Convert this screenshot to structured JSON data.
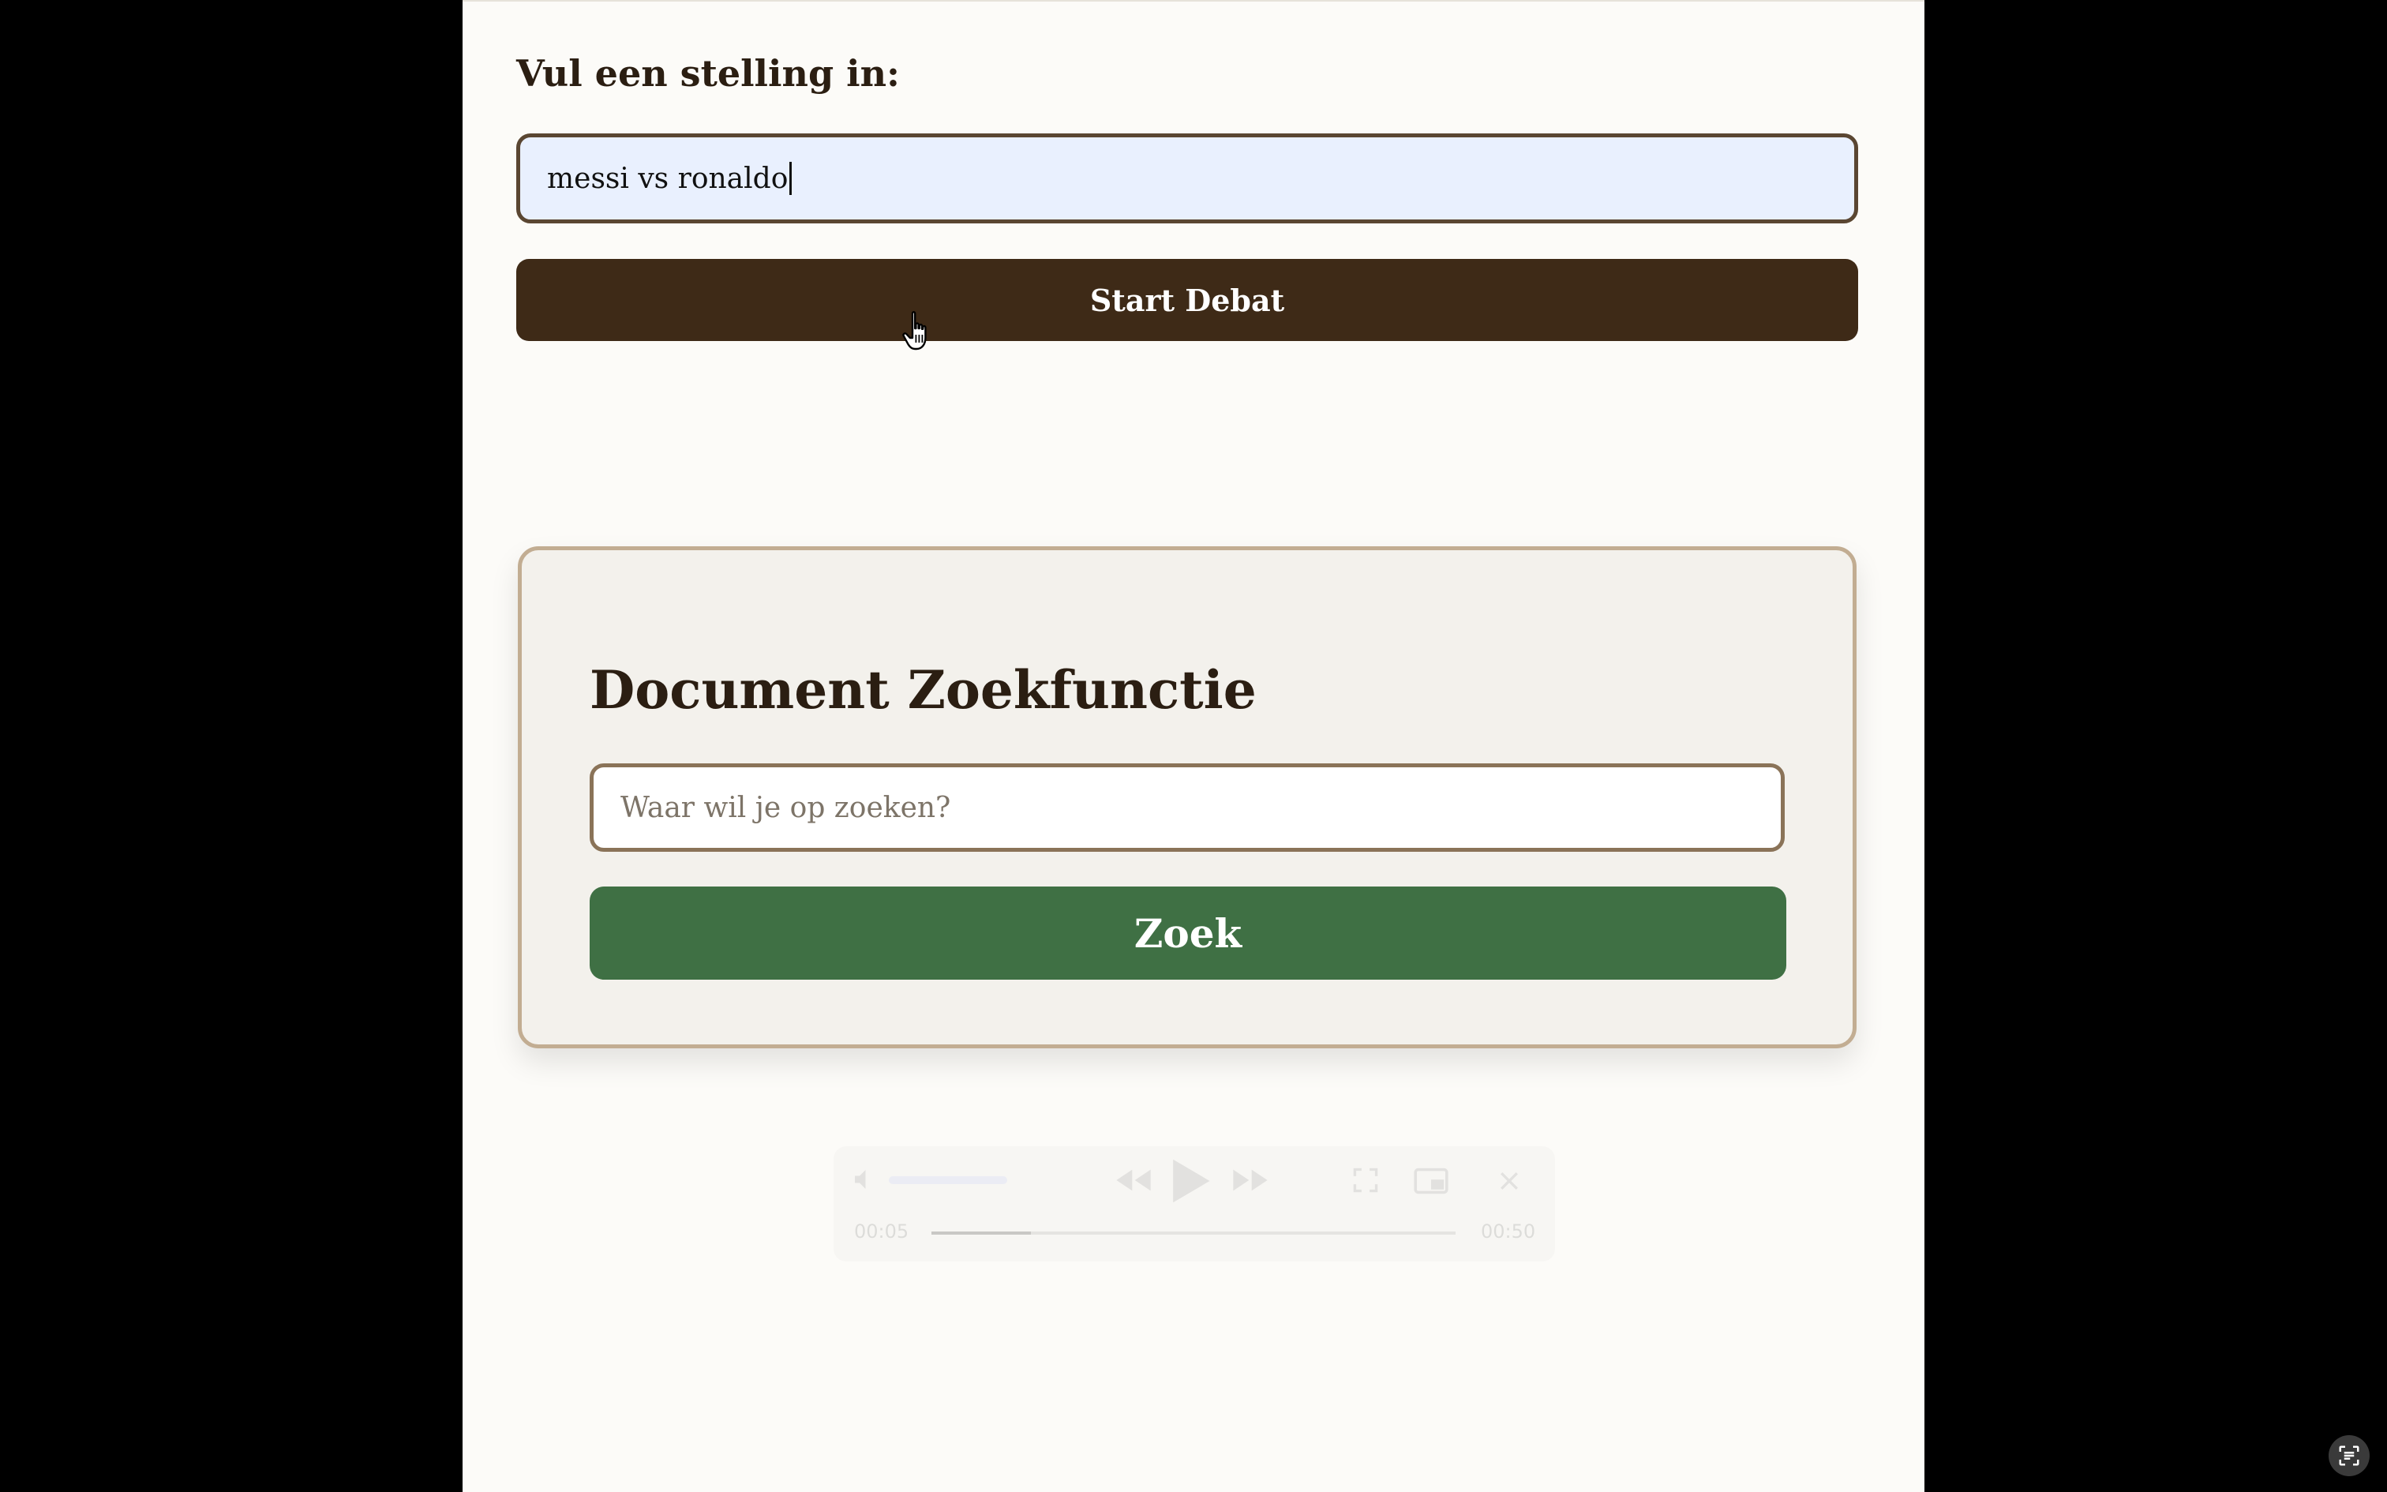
{
  "debate": {
    "label": "Vul een stelling in:",
    "input_value": "messi vs ronaldo",
    "start_button": "Start Debat"
  },
  "search": {
    "title": "Document Zoekfunctie",
    "placeholder": "Waar wil je op zoeken?",
    "button": "Zoek"
  },
  "media": {
    "current_time": "00:05",
    "total_time": "00:50",
    "progress": 0.19
  },
  "colors": {
    "page_background": "#fcfbf8",
    "debate_button": "#3e2a17",
    "search_button": "#3f7044",
    "debate_input_fill": "#e9f0fe",
    "card_border": "#c2ad92"
  },
  "icons": [
    "hand-pointer-cursor-icon",
    "volume-icon",
    "rewind-icon",
    "play-icon",
    "fast-forward-icon",
    "fullscreen-icon",
    "picture-in-picture-icon",
    "close-icon",
    "live-text-icon"
  ]
}
